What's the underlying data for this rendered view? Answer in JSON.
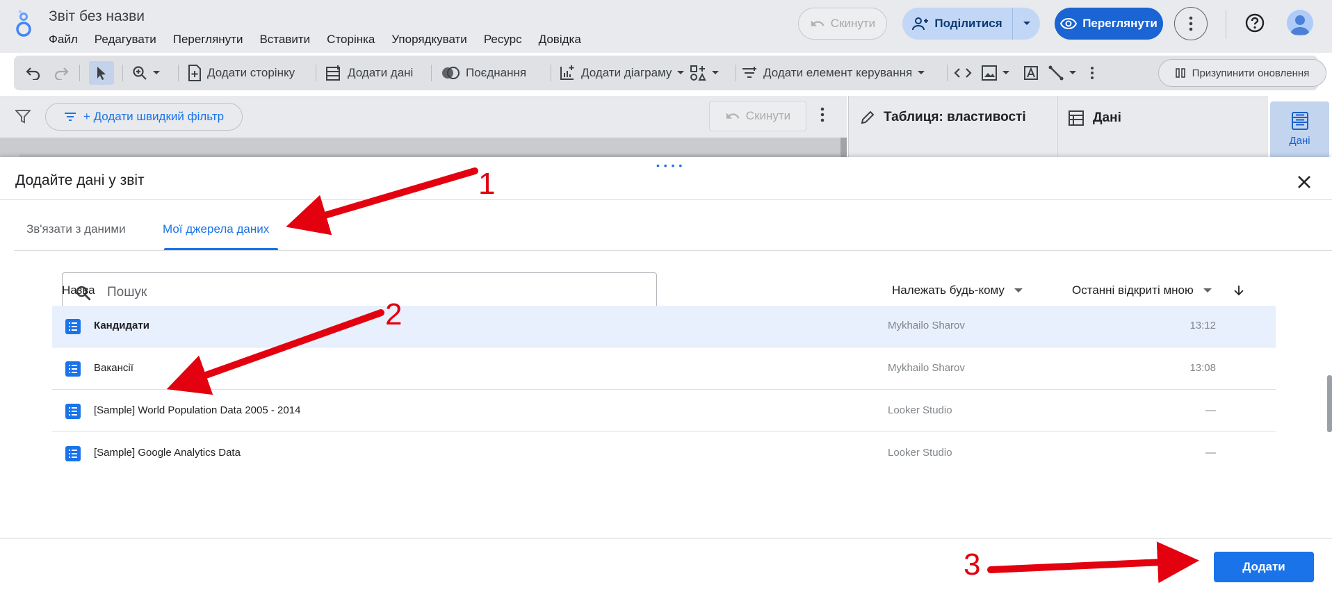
{
  "app": {
    "doc_title": "Звіт без назви",
    "menu": [
      "Файл",
      "Редагувати",
      "Переглянути",
      "Вставити",
      "Сторінка",
      "Упорядкувати",
      "Ресурс",
      "Довідка"
    ],
    "reset_label": "Скинути",
    "share_label": "Поділитися",
    "view_label": "Переглянути"
  },
  "toolbar": {
    "add_page": "Додати сторінку",
    "add_data": "Додати дані",
    "blend": "Поєднання",
    "add_chart": "Додати діаграму",
    "add_control": "Додати елемент керування",
    "pause_updates": "Призупинити оновлення"
  },
  "filterbar": {
    "quick_filter": "+ Додати швидкий фільтр",
    "reset_label": "Скинути"
  },
  "panels": {
    "properties_title": "Таблиця: властивості",
    "data_title": "Дані",
    "rail_label": "Дані"
  },
  "dialog": {
    "title": "Додайте дані у звіт",
    "tabs": [
      "Зв'язати з даними",
      "Мої джерела даних"
    ],
    "active_tab": 1,
    "search_placeholder": "Пошук",
    "columns": {
      "name": "Назва",
      "owner": "Належать будь-кому",
      "recent": "Останні відкриті мною"
    },
    "rows": [
      {
        "name": "Кандидати",
        "owner": "Mykhailo Sharov",
        "time": "13:12",
        "selected": true
      },
      {
        "name": "Вакансії",
        "owner": "Mykhailo Sharov",
        "time": "13:08",
        "selected": false
      },
      {
        "name": "[Sample] World Population Data 2005 - 2014",
        "owner": "Looker Studio",
        "time": "—",
        "selected": false
      },
      {
        "name": "[Sample] Google Analytics Data",
        "owner": "Looker Studio",
        "time": "—",
        "selected": false
      }
    ],
    "add_button": "Додати"
  },
  "annotations": [
    "1",
    "2",
    "3"
  ],
  "colors": {
    "accent": "#1a73e8",
    "selected_row": "#e8f0fe",
    "annotation": "#e3000f"
  }
}
